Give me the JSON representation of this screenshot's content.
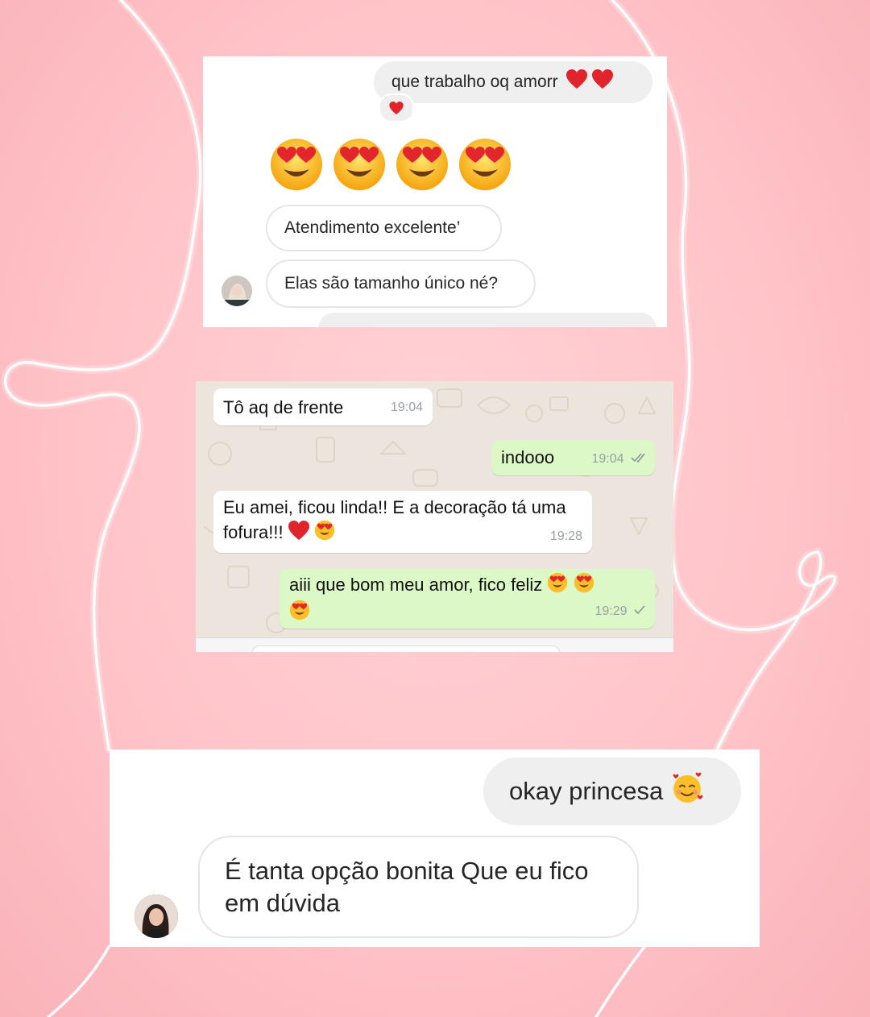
{
  "instagram_chat_1": {
    "outgoing_message": "que trabalho oq amorr",
    "outgoing_emoji": "❤️❤️",
    "reaction_emoji": "❤️",
    "emoji_message": [
      "heart-eyes-emoji",
      "heart-eyes-emoji",
      "heart-eyes-emoji",
      "heart-eyes-emoji"
    ],
    "incoming_messages": [
      "Atendimento excelente’",
      "Elas são tamanho único né?"
    ]
  },
  "whatsapp_chat": {
    "messages": [
      {
        "direction": "in",
        "text": "Tô aq de frente",
        "time": "19:04"
      },
      {
        "direction": "out",
        "text": "indooo",
        "time": "19:04",
        "status": "read"
      },
      {
        "direction": "in",
        "text": "Eu amei, ficou linda!! E a decoração tá uma fofura!!!",
        "time": "19:28"
      },
      {
        "direction": "out",
        "text": "aiii que bom meu amor, fico feliz",
        "time": "19:29",
        "status": "delivered"
      }
    ]
  },
  "instagram_chat_2": {
    "outgoing_message": "okay princesa",
    "outgoing_emoji": "smiling-face-with-hearts-emoji",
    "incoming_message": "É tanta opção bonita Que eu fico em dúvida"
  },
  "colors": {
    "background": "#ffc4c9",
    "whatsapp_outgoing": "#dcf8c6",
    "whatsapp_background": "#ece5dd",
    "heart": "#e0242c"
  }
}
